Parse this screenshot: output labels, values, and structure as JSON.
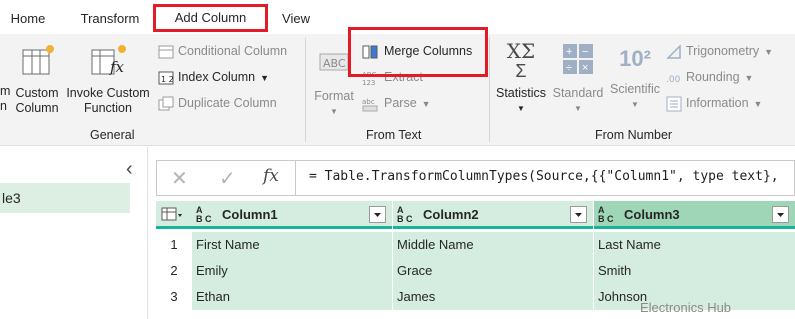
{
  "tabs": [
    {
      "label": "Home"
    },
    {
      "label": "Transform"
    },
    {
      "label": "Add Column"
    },
    {
      "label": "View"
    }
  ],
  "ribbon": {
    "general": {
      "group_label": "General",
      "column_from_examples": "m\nn",
      "custom_column": "Custom\nColumn",
      "invoke_custom_function": "Invoke Custom\nFunction",
      "conditional_column": "Conditional Column",
      "index_column": "Index Column",
      "duplicate_column": "Duplicate Column"
    },
    "from_text": {
      "group_label": "From Text",
      "format": "Format",
      "merge_columns": "Merge Columns",
      "extract": "Extract",
      "parse": "Parse"
    },
    "from_number": {
      "group_label": "From Number",
      "statistics": "Statistics",
      "standard": "Standard",
      "scientific": "Scientific",
      "trigonometry": "Trigonometry",
      "rounding": "Rounding",
      "information": "Information",
      "scientific_glyph": "10²",
      "statistics_glyph": "XΣ"
    }
  },
  "left_pane": {
    "selected_query": "le3",
    "collapse_glyph": "‹"
  },
  "formula_bar": {
    "cancel_glyph": "✕",
    "commit_glyph": "✓",
    "fx_glyph": "fx",
    "formula": "= Table.TransformColumnTypes(Source,{{\"Column1\", type text},"
  },
  "table": {
    "columns": [
      {
        "type_abc": "A",
        "type_bc": "B C",
        "label": "Column1"
      },
      {
        "type_abc": "A",
        "type_bc": "B C",
        "label": "Column2"
      },
      {
        "type_abc": "A",
        "type_bc": "B C",
        "label": "Column3"
      }
    ],
    "rows": [
      {
        "num": "1",
        "cells": [
          "First Name",
          "Middle Name",
          "Last Name"
        ]
      },
      {
        "num": "2",
        "cells": [
          "Emily",
          "Grace",
          "Smith"
        ]
      },
      {
        "num": "3",
        "cells": [
          "Ethan",
          "James",
          "Johnson"
        ]
      }
    ]
  },
  "watermark": "Electronics Hub",
  "colors": {
    "highlight": "#e21b27",
    "header_bg": "#d4ede0",
    "header_selected_bg": "#9fd6b7",
    "header_rule": "#17b39b"
  }
}
